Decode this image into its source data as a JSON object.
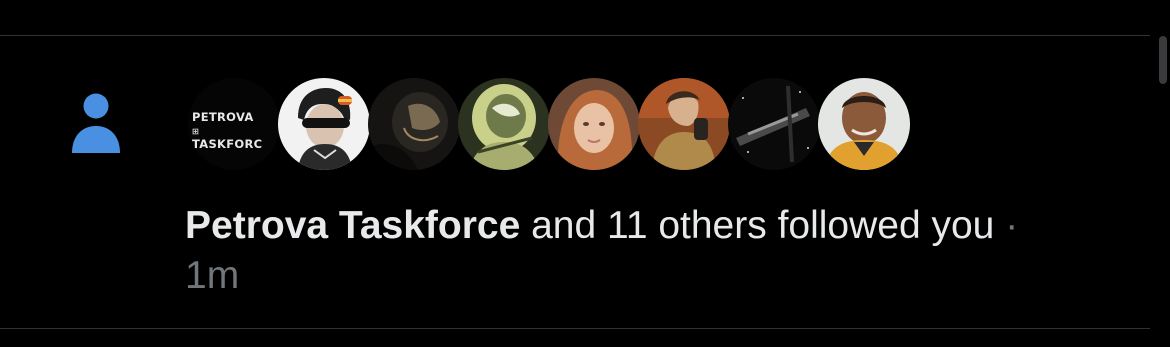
{
  "notification": {
    "type_icon": "person-icon",
    "actor_name": "Petrova Taskforce",
    "rest_text": " and 11 others followed you",
    "separator": " ·",
    "time": "1m"
  },
  "avatars": [
    {
      "name": "petrova-taskforce-logo",
      "line1": "PETROVA",
      "line1_suffix": "⊞",
      "line2": "TASKFORC"
    },
    {
      "name": "follower-avatar-2"
    },
    {
      "name": "follower-avatar-3"
    },
    {
      "name": "follower-avatar-4"
    },
    {
      "name": "follower-avatar-5"
    },
    {
      "name": "follower-avatar-6"
    },
    {
      "name": "follower-avatar-7"
    },
    {
      "name": "follower-avatar-8"
    }
  ],
  "colors": {
    "background": "#000000",
    "text": "#e7e9ea",
    "muted": "#71767b",
    "icon_blue": "#4a90e2",
    "divider": "#2f3336"
  }
}
